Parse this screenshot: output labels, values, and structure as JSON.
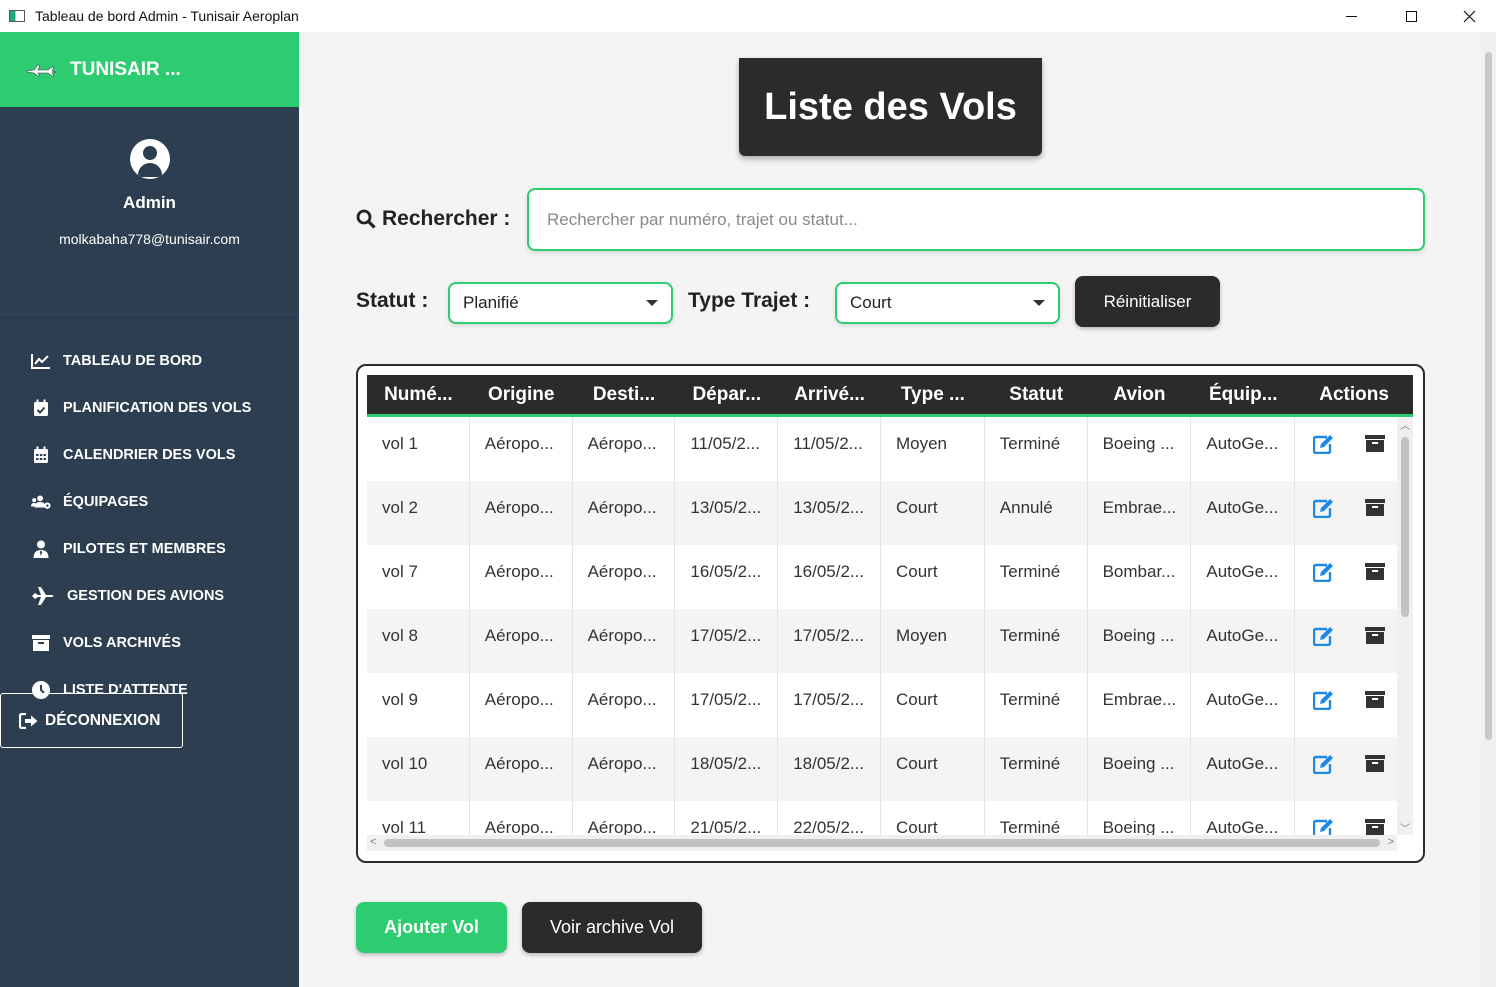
{
  "window": {
    "title": "Tableau de bord Admin - Tunisair Aeroplan"
  },
  "colors": {
    "accent": "#2ecc71",
    "sidebar": "#2c3e50",
    "dark": "#2b2b2b",
    "edit_icon": "#1e88e5"
  },
  "sidebar": {
    "brand": "TUNISAIR ...",
    "brand_icon": "airplane-logo",
    "profile_name": "Admin",
    "profile_email": "molkabaha778@tunisair.com",
    "items": [
      {
        "label": "TABLEAU DE BORD",
        "icon": "chart-line-icon"
      },
      {
        "label": "PLANIFICATION DES VOLS",
        "icon": "calendar-check-icon"
      },
      {
        "label": "CALENDRIER DES VOLS",
        "icon": "calendar-icon"
      },
      {
        "label": "ÉQUIPAGES",
        "icon": "users-cog-icon"
      },
      {
        "label": "PILOTES ET MEMBRES",
        "icon": "user-tie-icon"
      },
      {
        "label": "GESTION DES AVIONS",
        "icon": "plane-icon"
      },
      {
        "label": "VOLS ARCHIVÉS",
        "icon": "archive-icon"
      },
      {
        "label": "LISTE D'ATTENTE",
        "icon": "clock-icon"
      }
    ],
    "logout": "DÉCONNEXION"
  },
  "main": {
    "title": "Liste des Vols",
    "search_label": "Rechercher :",
    "search_placeholder": "Rechercher par numéro, trajet ou statut...",
    "search_value": "",
    "status_label": "Statut :",
    "status_value": "Planifié",
    "type_label": "Type Trajet :",
    "type_value": "Court",
    "reset": "Réinitialiser",
    "add_button": "Ajouter Vol",
    "archive_button": "Voir archive Vol"
  },
  "table": {
    "columns": [
      "Numé...",
      "Origine",
      "Desti...",
      "Dépar...",
      "Arrivé...",
      "Type ...",
      "Statut",
      "Avion",
      "Équip...",
      "Actions"
    ],
    "rows": [
      [
        "vol 1",
        "Aéropo...",
        "Aéropo...",
        "11/05/2...",
        "11/05/2...",
        "Moyen",
        "Terminé",
        "Boeing ...",
        "AutoGe..."
      ],
      [
        "vol 2",
        "Aéropo...",
        "Aéropo...",
        "13/05/2...",
        "13/05/2...",
        "Court",
        "Annulé",
        "Embrae...",
        "AutoGe..."
      ],
      [
        "vol 7",
        "Aéropo...",
        "Aéropo...",
        "16/05/2...",
        "16/05/2...",
        "Court",
        "Terminé",
        "Bombar...",
        "AutoGe..."
      ],
      [
        "vol 8",
        "Aéropo...",
        "Aéropo...",
        "17/05/2...",
        "17/05/2...",
        "Moyen",
        "Terminé",
        "Boeing ...",
        "AutoGe..."
      ],
      [
        "vol 9",
        "Aéropo...",
        "Aéropo...",
        "17/05/2...",
        "17/05/2...",
        "Court",
        "Terminé",
        "Embrae...",
        "AutoGe..."
      ],
      [
        "vol 10",
        "Aéropo...",
        "Aéropo...",
        "18/05/2...",
        "18/05/2...",
        "Court",
        "Terminé",
        "Boeing ...",
        "AutoGe..."
      ],
      [
        "vol 11",
        "Aéropo...",
        "Aéropo...",
        "21/05/2...",
        "22/05/2...",
        "Court",
        "Terminé",
        "Boeing ...",
        "AutoGe..."
      ]
    ],
    "row_actions": [
      "edit-icon",
      "archive-icon"
    ]
  }
}
